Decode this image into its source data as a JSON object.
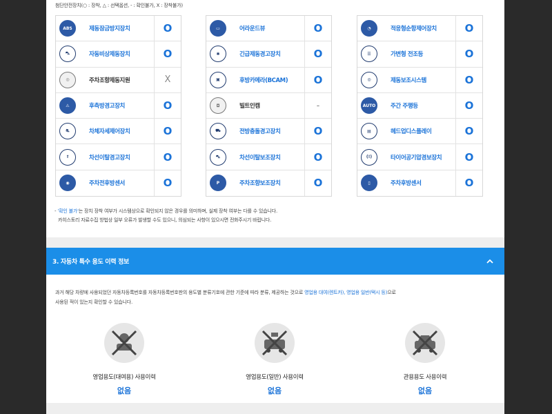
{
  "legend": "첨단안전장치(○ : 장착, △ : 선택옵션, - : 확인불가, X : 장착불가)",
  "options": {
    "col1": [
      {
        "icon": "abs-icon",
        "glyph": "ABS",
        "name": "제동잠금방지장치",
        "value": "O"
      },
      {
        "icon": "emergency-brake-icon",
        "glyph": "⛍",
        "name": "자동비상제동장치",
        "value": "O"
      },
      {
        "icon": "parking-steer-icon",
        "glyph": "◎",
        "name": "주차조향제동지원",
        "value": "X"
      },
      {
        "icon": "rear-cross-icon",
        "glyph": "⚠",
        "name": "후측방경고장치",
        "value": "O"
      },
      {
        "icon": "stability-icon",
        "glyph": "⛐",
        "name": "차체자세제어장치",
        "value": "O"
      },
      {
        "icon": "lane-warning-icon",
        "glyph": "⇑",
        "name": "차선이탈경고장치",
        "value": "O"
      },
      {
        "icon": "parking-sensor-front-icon",
        "glyph": "◉",
        "name": "주차전후방센서",
        "value": "O"
      }
    ],
    "col2": [
      {
        "icon": "around-view-icon",
        "glyph": "▭",
        "name": "어라운드뷰",
        "value": "O"
      },
      {
        "icon": "emergency-light-icon",
        "glyph": "✱",
        "name": "긴급제동경고장치",
        "value": "O"
      },
      {
        "icon": "rear-camera-icon",
        "glyph": "▣",
        "name": "후방카메라(BCAM)",
        "value": "O"
      },
      {
        "icon": "builtin-cam-icon",
        "glyph": "◘",
        "name": "빌트인캠",
        "value": "-"
      },
      {
        "icon": "front-collision-icon",
        "glyph": "⛟",
        "name": "전방충돌경고장치",
        "value": "O"
      },
      {
        "icon": "lane-keep-icon",
        "glyph": "⛍",
        "name": "차선이탈보조장치",
        "value": "O"
      },
      {
        "icon": "parking-assist-icon",
        "glyph": "P",
        "name": "주차조향보조장치",
        "value": "O"
      }
    ],
    "col3": [
      {
        "icon": "adaptive-cruise-icon",
        "glyph": "◔",
        "name": "적응형순항제어장치",
        "value": "O"
      },
      {
        "icon": "adaptive-headlamp-icon",
        "glyph": "☰",
        "name": "가변형 전조등",
        "value": "O"
      },
      {
        "icon": "brake-assist-icon",
        "glyph": "◎",
        "name": "제동보조시스템",
        "value": "O"
      },
      {
        "icon": "daytime-light-icon",
        "glyph": "AUTO",
        "name": "주간 주행등",
        "value": "O"
      },
      {
        "icon": "hud-icon",
        "glyph": "▤",
        "name": "헤드업디스플레이",
        "value": "O"
      },
      {
        "icon": "tire-pressure-icon",
        "glyph": "(!)",
        "name": "타이어공기압경보장치",
        "value": "O"
      },
      {
        "icon": "rear-sensor-icon",
        "glyph": "▯",
        "name": "주차후방센서",
        "value": "O"
      }
    ]
  },
  "notes": {
    "line1_prefix": "- ",
    "line1_hl": "'확인 불가'",
    "line1_mid": "는 장치 장착 여부가 시스템상으로 확인되지 않은 경우를 의미하며, 실제 장착 여부는 다를 수 있습니다.",
    "line2": "카히스토리 자료수집 방법상 일부 오류가 발생할 수도 있으니, 의심되는 사항이 있으시면 전화주시기 바랍니다."
  },
  "section": {
    "title": "3. 자동차 특수 용도 이력 정보",
    "desc_a": "과거 해당 차량에 사용되었던 자동차등록번호를 자동차등록번호판의 용도별 분류기호에 관한 기준에 따라 분류, 제공하는 것으로 ",
    "desc_hl": "영업용 대여(렌트카), 영업용 일반(택시 등)",
    "desc_b": "으로",
    "desc_c": "사용된 적이 있는지 확인할 수 있습니다."
  },
  "usage": [
    {
      "label": "영업용도(대여용) 사용이력",
      "value": "없음",
      "icon": "rental-car-icon"
    },
    {
      "label": "영업용도(일반) 사용이력",
      "value": "없음",
      "icon": "taxi-icon"
    },
    {
      "label": "관용용도 사용이력",
      "value": "없음",
      "icon": "government-car-icon"
    }
  ],
  "colors": {
    "accent": "#1b8ee8",
    "link": "#1b73d8"
  }
}
